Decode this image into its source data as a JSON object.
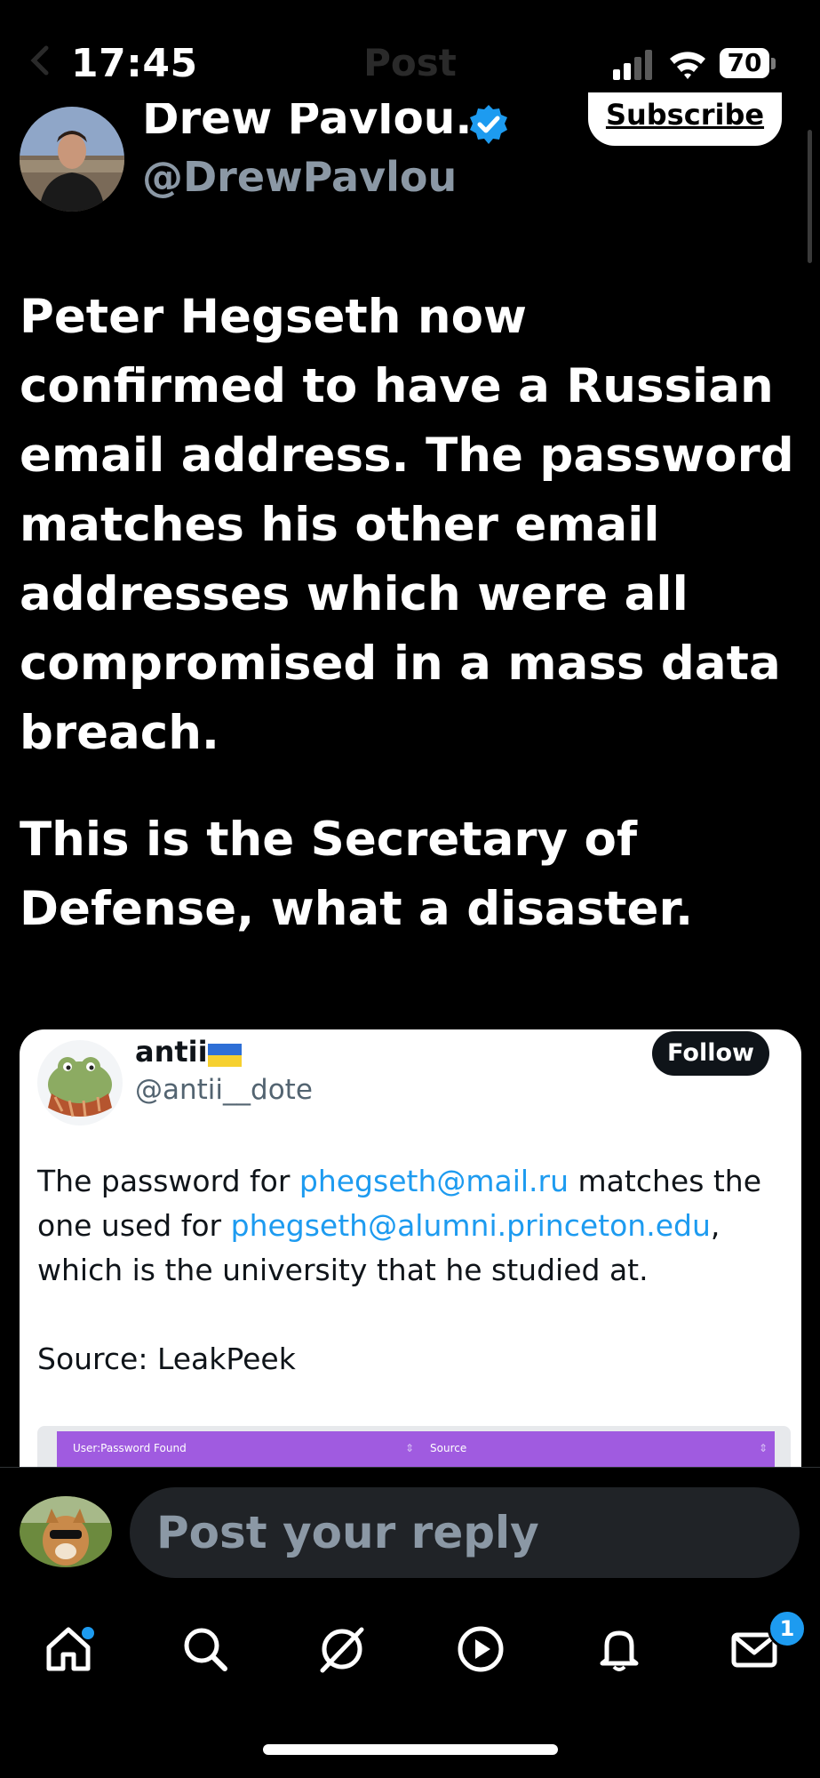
{
  "status_bar": {
    "time": "17:45",
    "ghost_title": "Post",
    "battery": "70"
  },
  "author": {
    "name": "Drew Pavlou...",
    "handle": "@DrewPavlou",
    "verified": true,
    "subscribe_label": "Subscribe"
  },
  "tweet": {
    "paragraphs": [
      "Peter Hegseth now confirmed to have a Russian email address. The password matches his other email addresses which were all compromised in a mass data breach.",
      "This is the Secretary of Defense, what a disaster."
    ]
  },
  "quoted_post": {
    "name": "antii",
    "flag": "ukraine-flag-icon",
    "handle": "@antii__dote",
    "follow_label": "Follow",
    "text_part1": "The password for ",
    "link1": "phegseth@mail.ru",
    "text_part2": " matches the one used for ",
    "link2": "phegseth@alumni.princeton.edu",
    "text_part3": ", which is the university that he studied at.",
    "source": "Source: LeakPeek",
    "table": {
      "col1": "User:Password Found",
      "col2": "Source",
      "sort_glyph": "⇕"
    }
  },
  "reply": {
    "placeholder": "Post your reply"
  },
  "bottom_nav": {
    "items": [
      "home-icon",
      "search-icon",
      "grok-icon",
      "video-icon",
      "notifications-icon",
      "messages-icon"
    ],
    "messages_badge": "1"
  },
  "colors": {
    "accent": "#1d9bf0",
    "background": "#000000",
    "handle_gray": "#8b98a5"
  }
}
